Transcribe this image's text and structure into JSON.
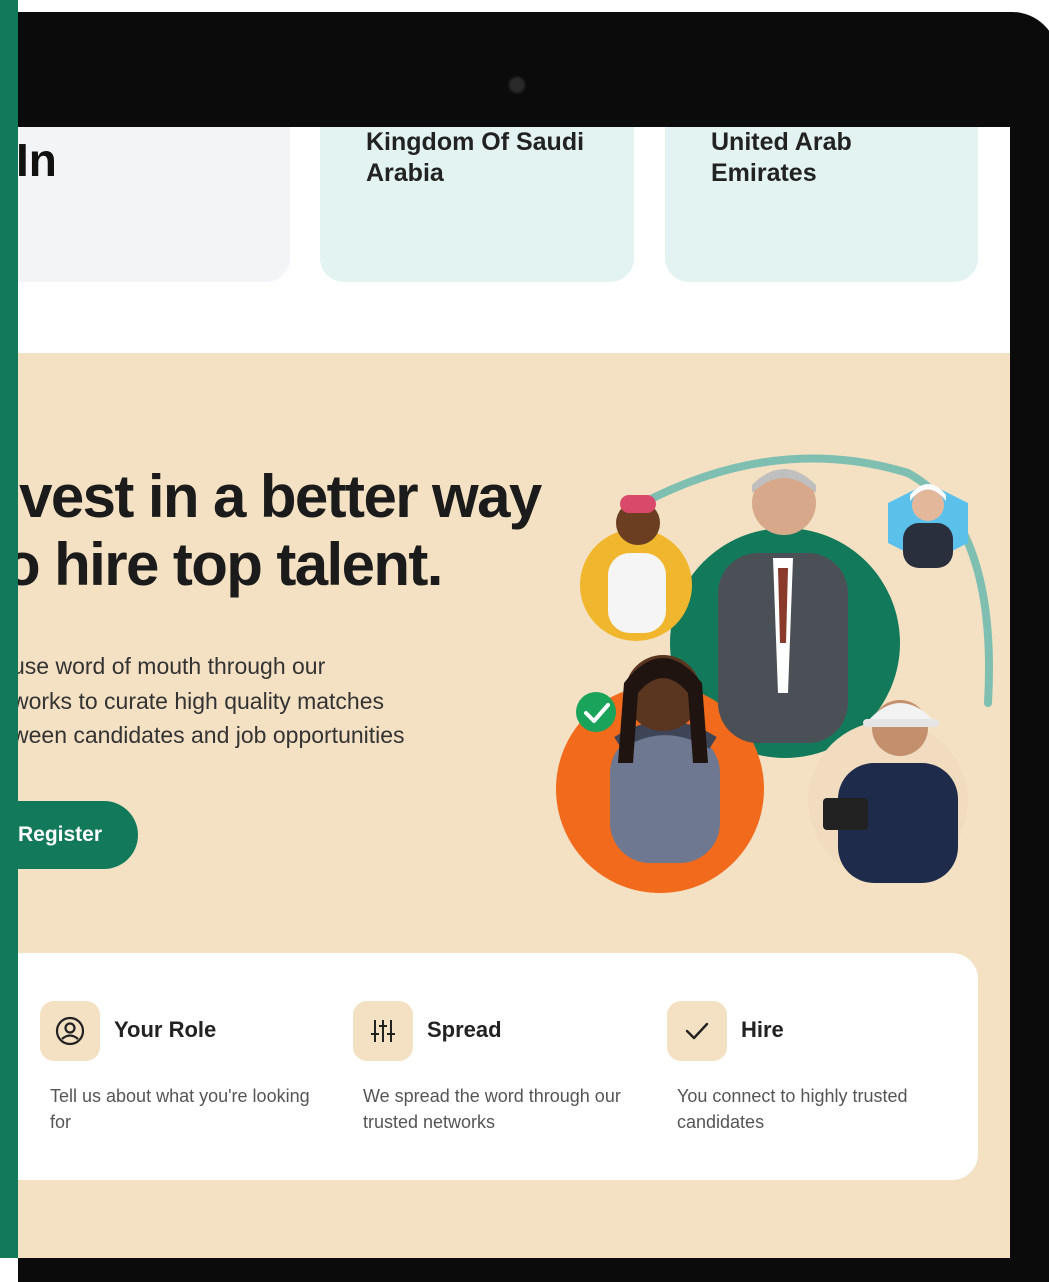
{
  "location_cards": {
    "left_partial": "In",
    "saudi": [
      "Kingdom Of Saudi",
      "Arabia"
    ],
    "uae": [
      "United Arab",
      "Emirates"
    ]
  },
  "hero": {
    "headline_lines": [
      "ivest in a better way",
      "o hire top talent."
    ],
    "subtext_lines": [
      "use word of mouth through our",
      "works to curate high quality matches",
      "ween candidates and job opportunities"
    ],
    "register_label": "Register"
  },
  "steps": [
    {
      "icon": "user-circle-icon",
      "title": "Your Role",
      "description": "Tell us about what you're looking for"
    },
    {
      "icon": "sliders-icon",
      "title": "Spread",
      "description": "We spread the word through our trusted networks"
    },
    {
      "icon": "check-icon",
      "title": "Hire",
      "description": "You connect to highly trusted candidates"
    }
  ],
  "colors": {
    "brand_green": "#127a5b",
    "hero_bg": "#f4e1c3",
    "card_teal": "#e2f3f2",
    "accent_orange": "#f26a1b",
    "accent_yellow": "#f0b62d",
    "accent_blue": "#5bc0ea",
    "arc_teal": "#7fbfb2"
  }
}
